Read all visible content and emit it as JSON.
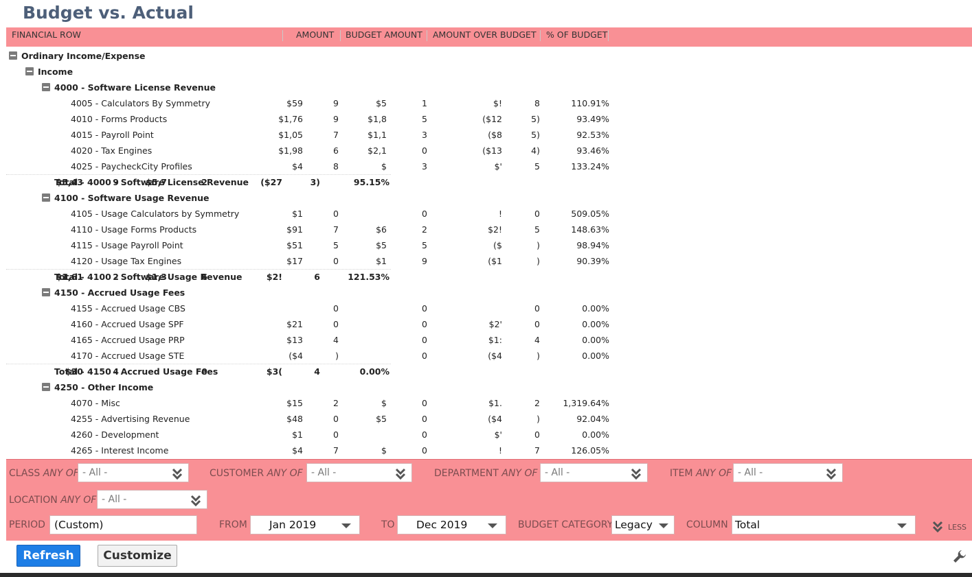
{
  "page_title": "Budget vs. Actual",
  "columns": {
    "financial_row": "FINANCIAL ROW",
    "amount": "AMOUNT",
    "budget_amount": "BUDGET AMOUNT",
    "over_budget": "AMOUNT OVER BUDGET",
    "pct_budget": "% OF BUDGET"
  },
  "rows": [
    {
      "label": "Ordinary Income/Expense",
      "level": 0,
      "toggle": true,
      "bold": true
    },
    {
      "label": "Income",
      "level": 1,
      "toggle": true,
      "bold": true
    },
    {
      "label": "4000 - Software License Revenue",
      "level": 2,
      "toggle": true,
      "bold": true
    },
    {
      "label": "4005 - Calculators By Symmetry",
      "level": 3,
      "amount": "$59",
      "amount_tail": "9",
      "budget": "$5",
      "budget_tail": "1",
      "over": "$!",
      "over_tail": "8",
      "pct": "110.91%"
    },
    {
      "label": "4010 - Forms Products",
      "level": 3,
      "amount": "$1,76",
      "amount_tail": "9",
      "budget": "$1,8",
      "budget_tail": "5",
      "over": "($12",
      "over_tail": "5)",
      "pct": "93.49%"
    },
    {
      "label": "4015 - Payroll Point",
      "level": 3,
      "amount": "$1,05",
      "amount_tail": "7",
      "budget": "$1,1",
      "budget_tail": "3",
      "over": "($8",
      "over_tail": "5)",
      "pct": "92.53%"
    },
    {
      "label": "4020 - Tax Engines",
      "level": 3,
      "amount": "$1,98",
      "amount_tail": "6",
      "budget": "$2,1",
      "budget_tail": "0",
      "over": "($13",
      "over_tail": "4)",
      "pct": "93.46%"
    },
    {
      "label": "4025 - PaycheckCity Profiles",
      "level": 3,
      "amount": "$4",
      "amount_tail": "8",
      "budget": "$",
      "budget_tail": "3",
      "over": "$'",
      "over_tail": "5",
      "pct": "133.24%"
    },
    {
      "label": "Total - 4000 - Software License Revenue",
      "level": 2,
      "total": true,
      "bold": true,
      "amount": "$5,43",
      "amount_tail": "9",
      "budget": "$5,7",
      "budget_tail": "2",
      "over": "($27",
      "over_tail": "3)",
      "pct": "95.15%"
    },
    {
      "label": "4100 - Software Usage Revenue",
      "level": 2,
      "toggle": true,
      "bold": true
    },
    {
      "label": "4105 - Usage Calculators by Symmetry",
      "level": 3,
      "amount": "$1",
      "amount_tail": "0",
      "budget": "",
      "budget_tail": "0",
      "over": "!",
      "over_tail": "0",
      "pct": "509.05%"
    },
    {
      "label": "4110 - Usage Forms Products",
      "level": 3,
      "amount": "$91",
      "amount_tail": "7",
      "budget": "$6",
      "budget_tail": "2",
      "over": "$2!",
      "over_tail": "5",
      "pct": "148.63%"
    },
    {
      "label": "4115 - Usage Payroll Point",
      "level": 3,
      "amount": "$51",
      "amount_tail": "5",
      "budget": "$5",
      "budget_tail": "5",
      "over": "($",
      "over_tail": ")",
      "pct": "98.94%"
    },
    {
      "label": "4120 - Usage Tax Engines",
      "level": 3,
      "amount": "$17",
      "amount_tail": "0",
      "budget": "$1",
      "budget_tail": "9",
      "over": "($1",
      "over_tail": ")",
      "pct": "90.39%"
    },
    {
      "label": "Total - 4100 - Software Usage Revenue",
      "level": 2,
      "total": true,
      "bold": true,
      "amount": "$1,61",
      "amount_tail": "2",
      "budget": "$1,3",
      "budget_tail": "6",
      "over": "$2!",
      "over_tail": "6",
      "pct": "121.53%"
    },
    {
      "label": "4150 - Accrued Usage Fees",
      "level": 2,
      "toggle": true,
      "bold": true
    },
    {
      "label": "4155 - Accrued Usage CBS",
      "level": 3,
      "amount": "",
      "amount_tail": "0",
      "budget": "",
      "budget_tail": "0",
      "over": "",
      "over_tail": "0",
      "pct": "0.00%"
    },
    {
      "label": "4160 - Accrued Usage SPF",
      "level": 3,
      "amount": "$21",
      "amount_tail": "0",
      "budget": "",
      "budget_tail": "0",
      "over": "$2'",
      "over_tail": "0",
      "pct": "0.00%"
    },
    {
      "label": "4165 - Accrued Usage PRP",
      "level": 3,
      "amount": "$13",
      "amount_tail": "4",
      "budget": "",
      "budget_tail": "0",
      "over": "$1:",
      "over_tail": "4",
      "pct": "0.00%"
    },
    {
      "label": "4170 - Accrued Usage STE",
      "level": 3,
      "amount": "($4",
      "amount_tail": ")",
      "budget": "",
      "budget_tail": "0",
      "over": "($4",
      "over_tail": ")",
      "pct": "0.00%"
    },
    {
      "label": "Total - 4150 - Accrued Usage Fees",
      "level": 2,
      "total": true,
      "bold": true,
      "amount": "$30",
      "amount_tail": "4",
      "budget": "",
      "budget_tail": "0",
      "over": "$3(",
      "over_tail": "4",
      "pct": "0.00%"
    },
    {
      "label": "4250 - Other Income",
      "level": 2,
      "toggle": true,
      "bold": true
    },
    {
      "label": "4070 - Misc",
      "level": 3,
      "amount": "$15",
      "amount_tail": "2",
      "budget": "$",
      "budget_tail": "0",
      "over": "$1.",
      "over_tail": "2",
      "pct": "1,319.64%"
    },
    {
      "label": "4255 - Advertising Revenue",
      "level": 3,
      "amount": "$48",
      "amount_tail": "0",
      "budget": "$5",
      "budget_tail": "0",
      "over": "($4",
      "over_tail": ")",
      "pct": "92.04%"
    },
    {
      "label": "4260 - Development",
      "level": 3,
      "amount": "$1",
      "amount_tail": "0",
      "budget": "",
      "budget_tail": "0",
      "over": "$'",
      "over_tail": "0",
      "pct": "0.00%"
    },
    {
      "label": "4265 - Interest Income",
      "level": 3,
      "amount": "$4",
      "amount_tail": "7",
      "budget": "$",
      "budget_tail": "0",
      "over": "!",
      "over_tail": "7",
      "pct": "126.05%"
    }
  ],
  "filters": {
    "class_label": "CLASS",
    "customer_label": "CUSTOMER",
    "department_label": "DEPARTMENT",
    "item_label": "ITEM",
    "location_label": "LOCATION",
    "any_of": "ANY OF",
    "all_value": "- All -",
    "period_label": "PERIOD",
    "period_value": "(Custom)",
    "from_label": "FROM",
    "from_value": "Jan 2019",
    "to_label": "TO",
    "to_value": "Dec 2019",
    "budget_category_label": "BUDGET CATEGORY",
    "budget_category_value": "Legacy",
    "column_label": "COLUMN",
    "column_value": "Total",
    "less_label": "LESS"
  },
  "buttons": {
    "refresh": "Refresh",
    "customize": "Customize"
  },
  "colors": {
    "header_bg": "#f99095",
    "title": "#4d5f79",
    "refresh_bg": "#1e7ee6"
  }
}
